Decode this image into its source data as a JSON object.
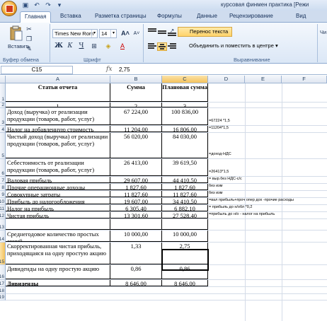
{
  "window": {
    "title": "курсовая финмен практика  [Режи"
  },
  "tabs": [
    "Главная",
    "Вставка",
    "Разметка страницы",
    "Формулы",
    "Данные",
    "Рецензирование",
    "Вид"
  ],
  "ribbon": {
    "paste_label": "Вставить",
    "clipboard_group": "Буфер обмена",
    "font_group": "Шрифт",
    "alignment_group": "Выравнивание",
    "font_name": "Times New Rom",
    "font_size": "14",
    "bold": "Ж",
    "italic": "К",
    "underline": "Ч",
    "wrap_text": "Перенос текста",
    "merge_center": "Объединить и поместить в центре",
    "num_short": "Чи"
  },
  "formula_bar": {
    "cell_ref": "C15",
    "fx": "fx",
    "value": "2,75"
  },
  "columns": [
    "A",
    "B",
    "C",
    "D",
    "E",
    "F"
  ],
  "table": {
    "headers": {
      "a": "Статьи отчета",
      "b": "Сумма",
      "c": "Плановая сумма"
    },
    "rows": [
      {
        "n": "1",
        "a": "Статьи отчета",
        "b": "Сумма",
        "c": "Плановая сумма",
        "d": ""
      },
      {
        "n": "2",
        "a": "1",
        "b": "2",
        "c": "3",
        "d": ""
      },
      {
        "n": "3",
        "a": "Доход (выручка) от реализации продукции (товаров, работ, услуг)",
        "b": "67 224,00",
        "c": "100 836,00",
        "d": "=67224 *1,5"
      },
      {
        "n": "4",
        "a": "Налог на добавленную стоимость",
        "b": "11 204,00",
        "c": "16 806,00",
        "d": "=11204*1,5"
      },
      {
        "n": "5",
        "a": "Чистый доход (выручка) от реализации продукции (товаров, работ, услуг)",
        "b": "56 020,00",
        "c": "84 030,00",
        "d": "=доход-НДС"
      },
      {
        "n": "6",
        "a": "Себестоимость от реализации продукции (товаров, работ, услуг)",
        "b": "26 413,00",
        "c": "39 619,50",
        "d": "=26413*1,5"
      },
      {
        "n": "7",
        "a": "Валовая прибыль",
        "b": "29 607,00",
        "c": "44 410,50",
        "d": "= выр.без НДС-с/с"
      },
      {
        "n": "8",
        "a": "Прочие операционные доходы",
        "b": "1 827,60",
        "c": "1 827,60",
        "d": "без изм"
      },
      {
        "n": "9",
        "a": "Совокупные затраты",
        "b": "11 827,60",
        "c": "11 827,60",
        "d": "без изм"
      },
      {
        "n": "10",
        "a": "Прибыль до налогообложения",
        "b": "19 607,00",
        "c": "34 410,50",
        "d": "=вал прибыль+проч опер дох -прочие расходы"
      },
      {
        "n": "11",
        "a": "Налог на прибыль",
        "b": "6 305,40",
        "c": "6 882,10",
        "d": "= прибыль до н/обл *0,2"
      },
      {
        "n": "12",
        "a": "Чистая прибыль",
        "b": "13 301,60",
        "c": "27 528,40",
        "d": "=прибыль до н/о - налог на прибыль"
      },
      {
        "n": "13",
        "a": "",
        "b": "",
        "c": "",
        "d": ""
      },
      {
        "n": "14",
        "a": "Среднегодовое количество простых акций",
        "b": "10 000,00",
        "c": "10 000,00",
        "d": ""
      },
      {
        "n": "15",
        "a": "Скорректированная чистая прибыль, приходящаяся на одну простую акцию",
        "b": "1,33",
        "c": "2,75",
        "d": ""
      },
      {
        "n": "16",
        "a": "Дивиденды на одну простую акцию",
        "b": "0,86",
        "c": "0,86",
        "d": ""
      },
      {
        "n": "17",
        "a": "Дивиденды",
        "b": "8 646,00",
        "c": "8 646,00",
        "d": ""
      },
      {
        "n": "18",
        "a": "",
        "b": "",
        "c": "",
        "d": ""
      },
      {
        "n": "19",
        "a": "",
        "b": "",
        "c": "",
        "d": ""
      }
    ]
  }
}
